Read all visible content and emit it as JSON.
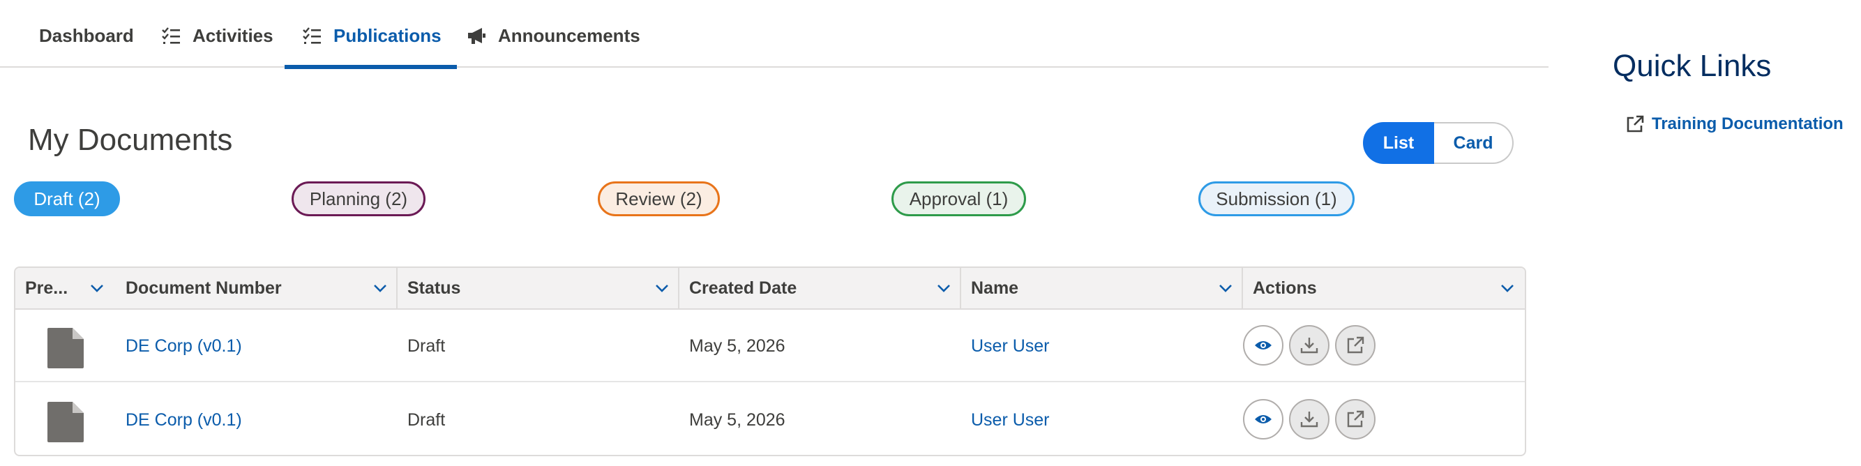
{
  "tabs": [
    {
      "label": "Dashboard",
      "icon": "none",
      "active": false
    },
    {
      "label": "Activities",
      "icon": "checklist-icon",
      "active": false
    },
    {
      "label": "Publications",
      "icon": "checklist-icon",
      "active": true
    },
    {
      "label": "Announcements",
      "icon": "megaphone-icon",
      "active": false
    }
  ],
  "main": {
    "title": "My Documents",
    "view_toggle": {
      "list": "List",
      "card": "Card",
      "selected": "List"
    },
    "status_filters": [
      {
        "label": "Draft (2)",
        "color": "#2e9be6",
        "selected": true
      },
      {
        "label": "Planning (2)",
        "color": "#6b1a55",
        "selected": false
      },
      {
        "label": "Review (2)",
        "color": "#e8741a",
        "selected": false
      },
      {
        "label": "Approval (1)",
        "color": "#2e9b4a",
        "selected": false
      },
      {
        "label": "Submission (1)",
        "color": "#2e9be6",
        "selected": false
      }
    ]
  },
  "table": {
    "columns": [
      "Pre...",
      "Document Number",
      "Status",
      "Created Date",
      "Name",
      "Actions"
    ],
    "rows": [
      {
        "document_number": "DE Corp (v0.1)",
        "status": "Draft",
        "created_date": "May 5, 2026",
        "name": "User User"
      },
      {
        "document_number": "DE Corp (v0.1)",
        "status": "Draft",
        "created_date": "May 5, 2026",
        "name": "User User"
      }
    ],
    "actions": [
      "eye-icon",
      "download-icon",
      "external-link-icon"
    ]
  },
  "quick_links": {
    "title": "Quick Links",
    "items": [
      {
        "label": "Training Documentation",
        "icon": "external-link-icon"
      }
    ]
  },
  "colors": {
    "accent": "#0b5cab",
    "toggle_selected": "#1170e5",
    "draft_fill": "#2e9be6"
  }
}
